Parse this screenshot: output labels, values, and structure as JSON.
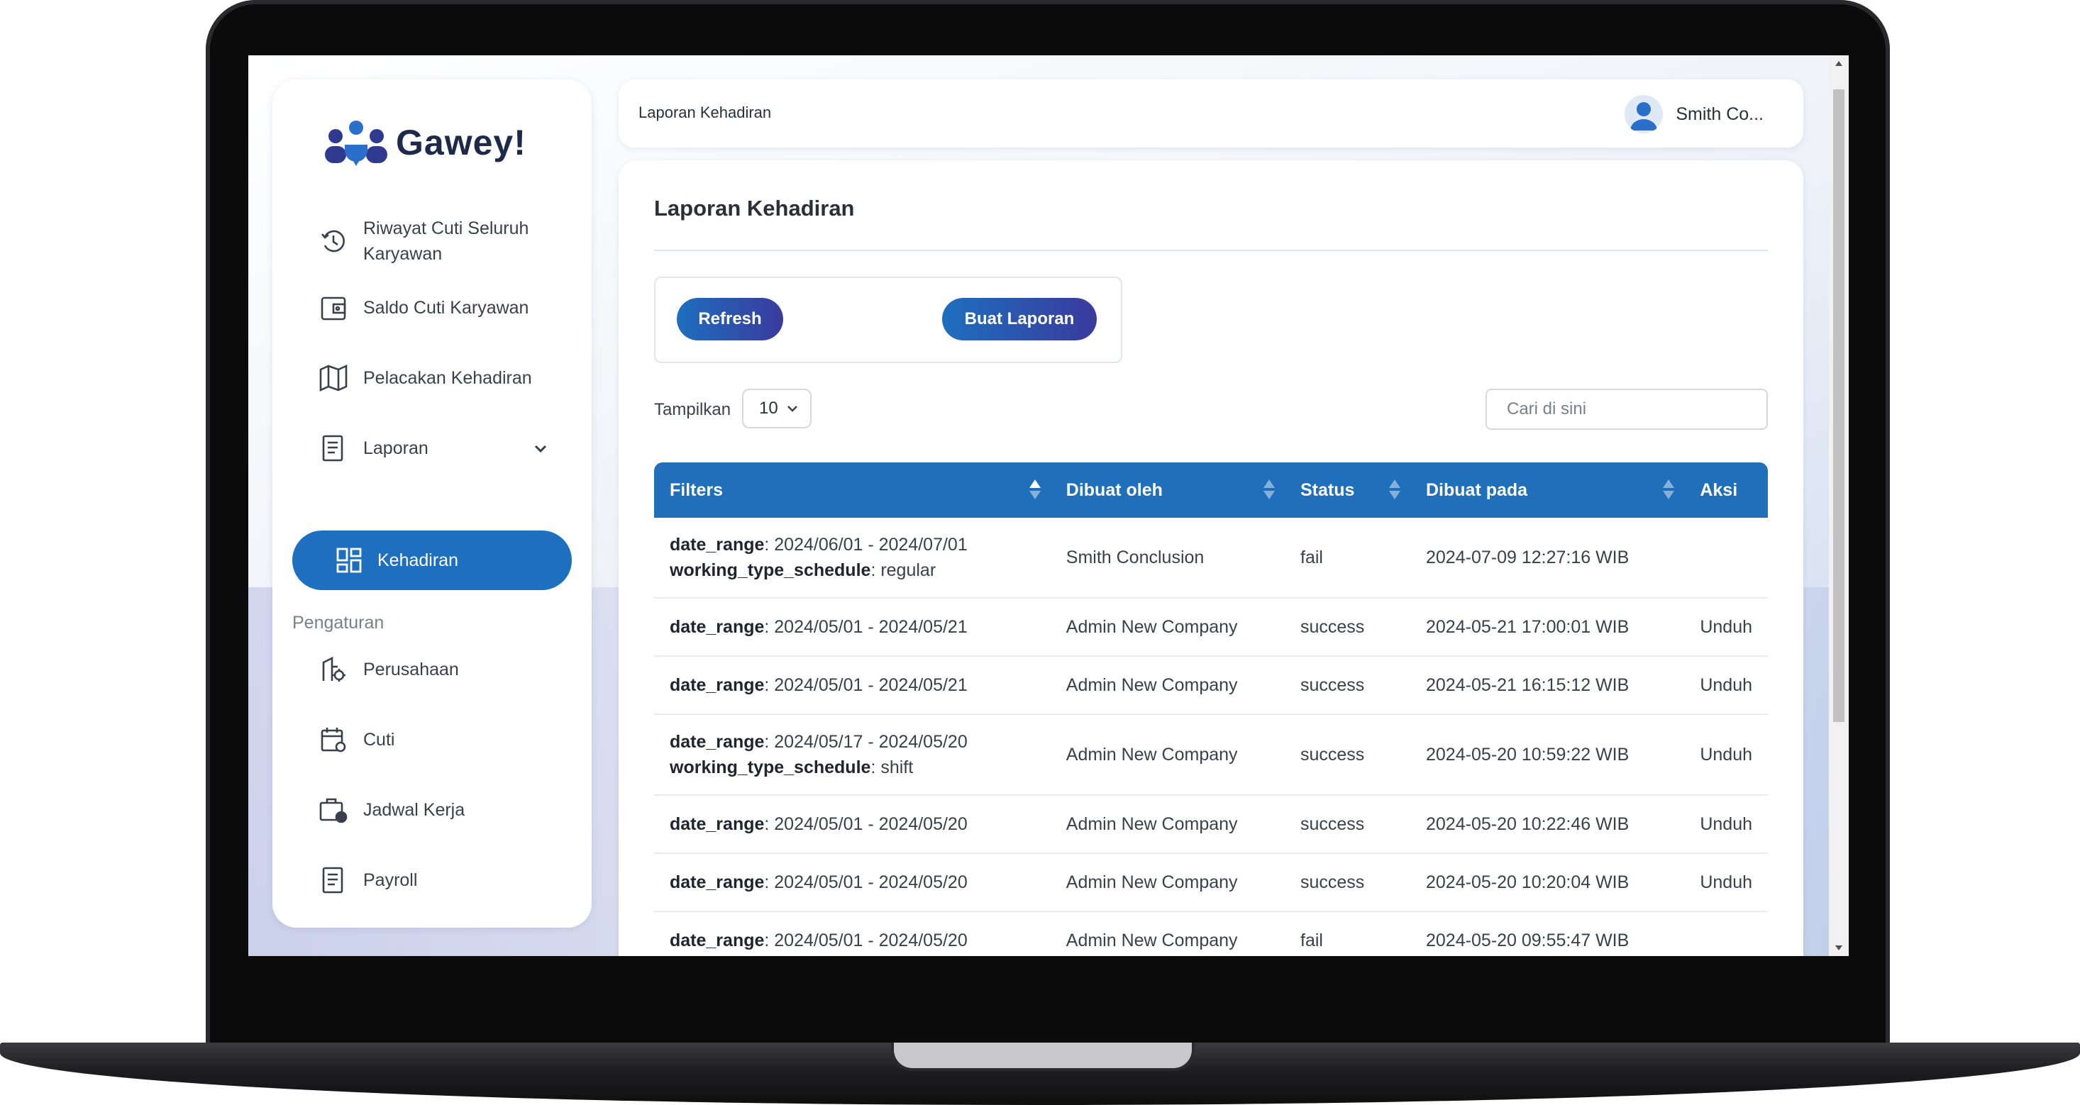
{
  "app": {
    "brand": "Gawey!"
  },
  "sidebar": {
    "items": [
      {
        "label": "Riwayat Cuti Seluruh Karyawan",
        "icon": "history-icon"
      },
      {
        "label": "Saldo Cuti Karyawan",
        "icon": "wallet-icon"
      },
      {
        "label": "Pelacakan Kehadiran",
        "icon": "map-icon"
      },
      {
        "label": "Laporan",
        "icon": "document-icon"
      },
      {
        "label": "Kehadiran",
        "icon": "dashboard-icon",
        "active": true
      }
    ],
    "section_label": "Pengaturan",
    "settings_items": [
      {
        "label": "Perusahaan",
        "icon": "company-settings-icon"
      },
      {
        "label": "Cuti",
        "icon": "calendar-settings-icon"
      },
      {
        "label": "Jadwal Kerja",
        "icon": "briefcase-clock-icon"
      },
      {
        "label": "Payroll",
        "icon": "document-icon"
      }
    ]
  },
  "header": {
    "breadcrumb": "Laporan Kehadiran",
    "user_name": "Smith Co..."
  },
  "main": {
    "title": "Laporan Kehadiran",
    "refresh_label": "Refresh",
    "create_label": "Buat Laporan",
    "show_label": "Tampilkan",
    "page_size": "10",
    "search_placeholder": "Cari di sini"
  },
  "table": {
    "columns": [
      "Filters",
      "Dibuat oleh",
      "Status",
      "Dibuat pada",
      "Aksi"
    ],
    "rows": [
      {
        "f1k": "date_range",
        "f1v": ": 2024/06/01 - 2024/07/01",
        "f2k": "working_type_schedule",
        "f2v": ": regular",
        "by": "Smith Conclusion",
        "status": "fail",
        "at": "2024-07-09 12:27:16 WIB",
        "action": ""
      },
      {
        "f1k": "date_range",
        "f1v": ": 2024/05/01 - 2024/05/21",
        "by": "Admin New Company",
        "status": "success",
        "at": "2024-05-21 17:00:01 WIB",
        "action": "Unduh"
      },
      {
        "f1k": "date_range",
        "f1v": ": 2024/05/01 - 2024/05/21",
        "by": "Admin New Company",
        "status": "success",
        "at": "2024-05-21 16:15:12 WIB",
        "action": "Unduh"
      },
      {
        "f1k": "date_range",
        "f1v": ": 2024/05/17 - 2024/05/20",
        "f2k": "working_type_schedule",
        "f2v": ": shift",
        "by": "Admin New Company",
        "status": "success",
        "at": "2024-05-20 10:59:22 WIB",
        "action": "Unduh"
      },
      {
        "f1k": "date_range",
        "f1v": ": 2024/05/01 - 2024/05/20",
        "by": "Admin New Company",
        "status": "success",
        "at": "2024-05-20 10:22:46 WIB",
        "action": "Unduh"
      },
      {
        "f1k": "date_range",
        "f1v": ": 2024/05/01 - 2024/05/20",
        "by": "Admin New Company",
        "status": "success",
        "at": "2024-05-20 10:20:04 WIB",
        "action": "Unduh"
      },
      {
        "f1k": "date_range",
        "f1v": ": 2024/05/01 - 2024/05/20",
        "by": "Admin New Company",
        "status": "fail",
        "at": "2024-05-20 09:55:47 WIB",
        "action": ""
      }
    ]
  },
  "colors": {
    "primary": "#1f6fba",
    "gradient_end": "#3a3a9c",
    "brand_dark": "#1e2a4a"
  }
}
